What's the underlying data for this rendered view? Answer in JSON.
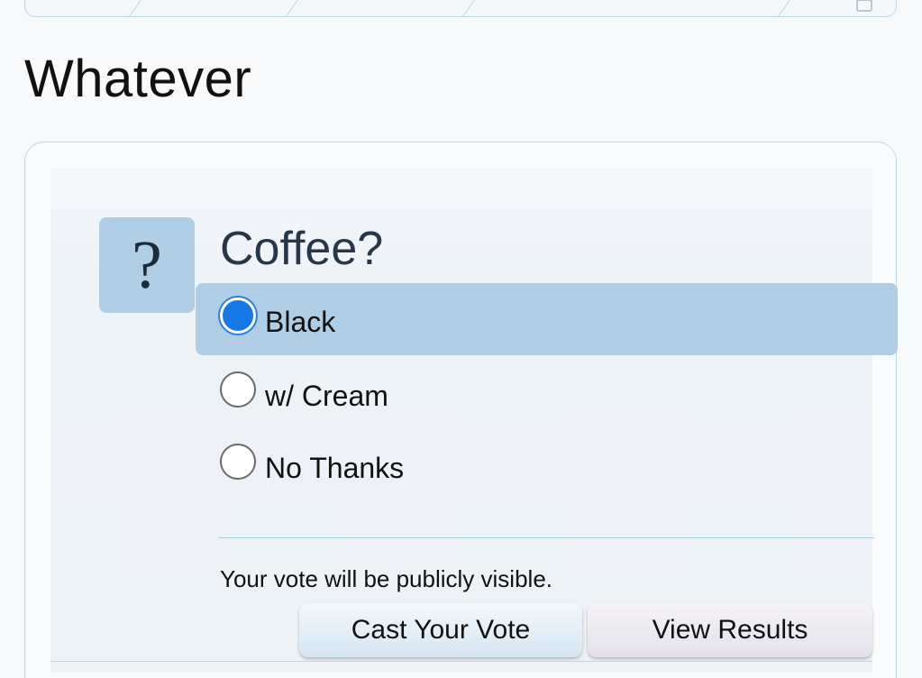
{
  "page": {
    "title": "Whatever"
  },
  "poll": {
    "icon": "question-mark-icon",
    "icon_glyph": "?",
    "question": "Coffee?",
    "options": [
      {
        "label": "Black",
        "selected": true
      },
      {
        "label": "w/ Cream",
        "selected": false
      },
      {
        "label": "No Thanks",
        "selected": false
      }
    ],
    "notice": "Your vote will be publicly visible.",
    "cast_vote_label": "Cast Your Vote",
    "view_results_label": "View Results"
  },
  "colors": {
    "selected_option_bg": "#afcde5",
    "radio_checked": "#1677e6",
    "border_accent": "#b9dbe6"
  }
}
